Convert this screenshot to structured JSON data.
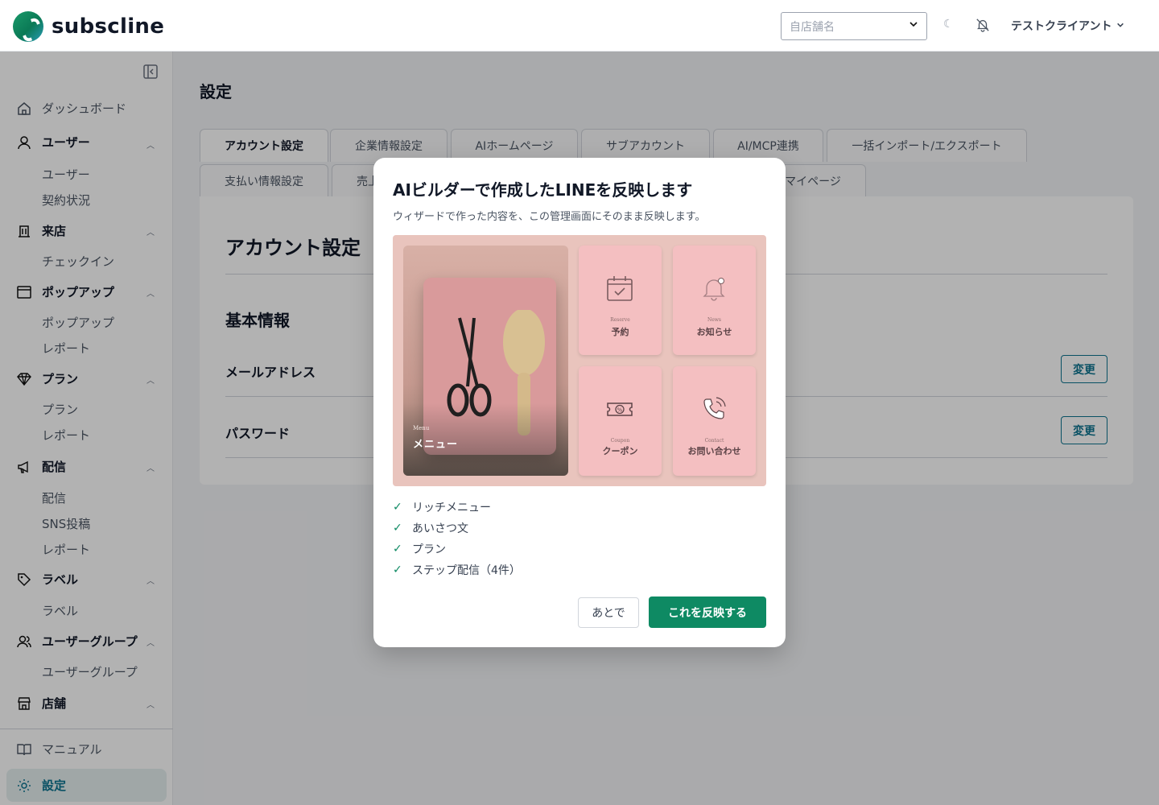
{
  "header": {
    "logo_text": "subscline",
    "store_select_placeholder": "自店舗名",
    "user_name": "テストクライアント"
  },
  "sidebar": {
    "items": [
      {
        "label": "ダッシュボード",
        "icon": "home-icon"
      },
      {
        "label": "ユーザー",
        "icon": "user-icon",
        "group": true,
        "children": [
          "ユーザー",
          "契約状況"
        ]
      },
      {
        "label": "来店",
        "icon": "building-icon",
        "group": true,
        "children": [
          "チェックイン"
        ]
      },
      {
        "label": "ポップアップ",
        "icon": "window-icon",
        "group": true,
        "children": [
          "ポップアップ",
          "レポート"
        ]
      },
      {
        "label": "プラン",
        "icon": "diamond-icon",
        "group": true,
        "children": [
          "プラン",
          "レポート"
        ]
      },
      {
        "label": "配信",
        "icon": "megaphone-icon",
        "group": true,
        "children": [
          "配信",
          "SNS投稿",
          "レポート"
        ]
      },
      {
        "label": "ラベル",
        "icon": "tag-icon",
        "group": true,
        "children": [
          "ラベル"
        ]
      },
      {
        "label": "ユーザーグループ",
        "icon": "users-icon",
        "group": true,
        "children": [
          "ユーザーグループ"
        ]
      },
      {
        "label": "店舗",
        "icon": "store-icon",
        "group": true,
        "children": []
      }
    ],
    "footer": [
      {
        "label": "マニュアル",
        "icon": "book-icon"
      },
      {
        "label": "設定",
        "icon": "gear-icon",
        "active": true
      }
    ]
  },
  "main": {
    "page_title": "設定",
    "tabs_row1": [
      "アカウント設定",
      "企業情報設定",
      "AIホームページ",
      "サブアカウント",
      "AI/MCP連携",
      "一括インポート/エクスポート"
    ],
    "tabs_row2": [
      "支払い情報設定",
      "売上",
      "マイページ"
    ],
    "section_title": "アカウント設定",
    "basic_info_title": "基本情報",
    "fields": [
      {
        "label": "メールアドレス",
        "button": "変更"
      },
      {
        "label": "パスワード",
        "button": "変更"
      }
    ]
  },
  "modal": {
    "title": "AIビルダーで作成したLINEを反映します",
    "subtitle": "ウィザードで作った内容を、この管理画面にそのまま反映します。",
    "preview": {
      "photo_small": "Menu",
      "photo_label": "メニュー",
      "tiles": [
        {
          "small": "Reserve",
          "label": "予約",
          "icon": "calendar-check-icon"
        },
        {
          "small": "News",
          "label": "お知らせ",
          "icon": "bell-icon"
        },
        {
          "small": "Coupon",
          "label": "クーポン",
          "icon": "coupon-icon"
        },
        {
          "small": "Contact",
          "label": "お問い合わせ",
          "icon": "phone-icon"
        }
      ]
    },
    "checklist": [
      "リッチメニュー",
      "あいさつ文",
      "プラン",
      "ステップ配信（4件）"
    ],
    "later_button": "あとで",
    "apply_button": "これを反映する"
  },
  "colors": {
    "brand_green": "#0e8a63",
    "teal_outline": "#0e7490",
    "overlay": "rgba(0,0,0,0.3)"
  }
}
